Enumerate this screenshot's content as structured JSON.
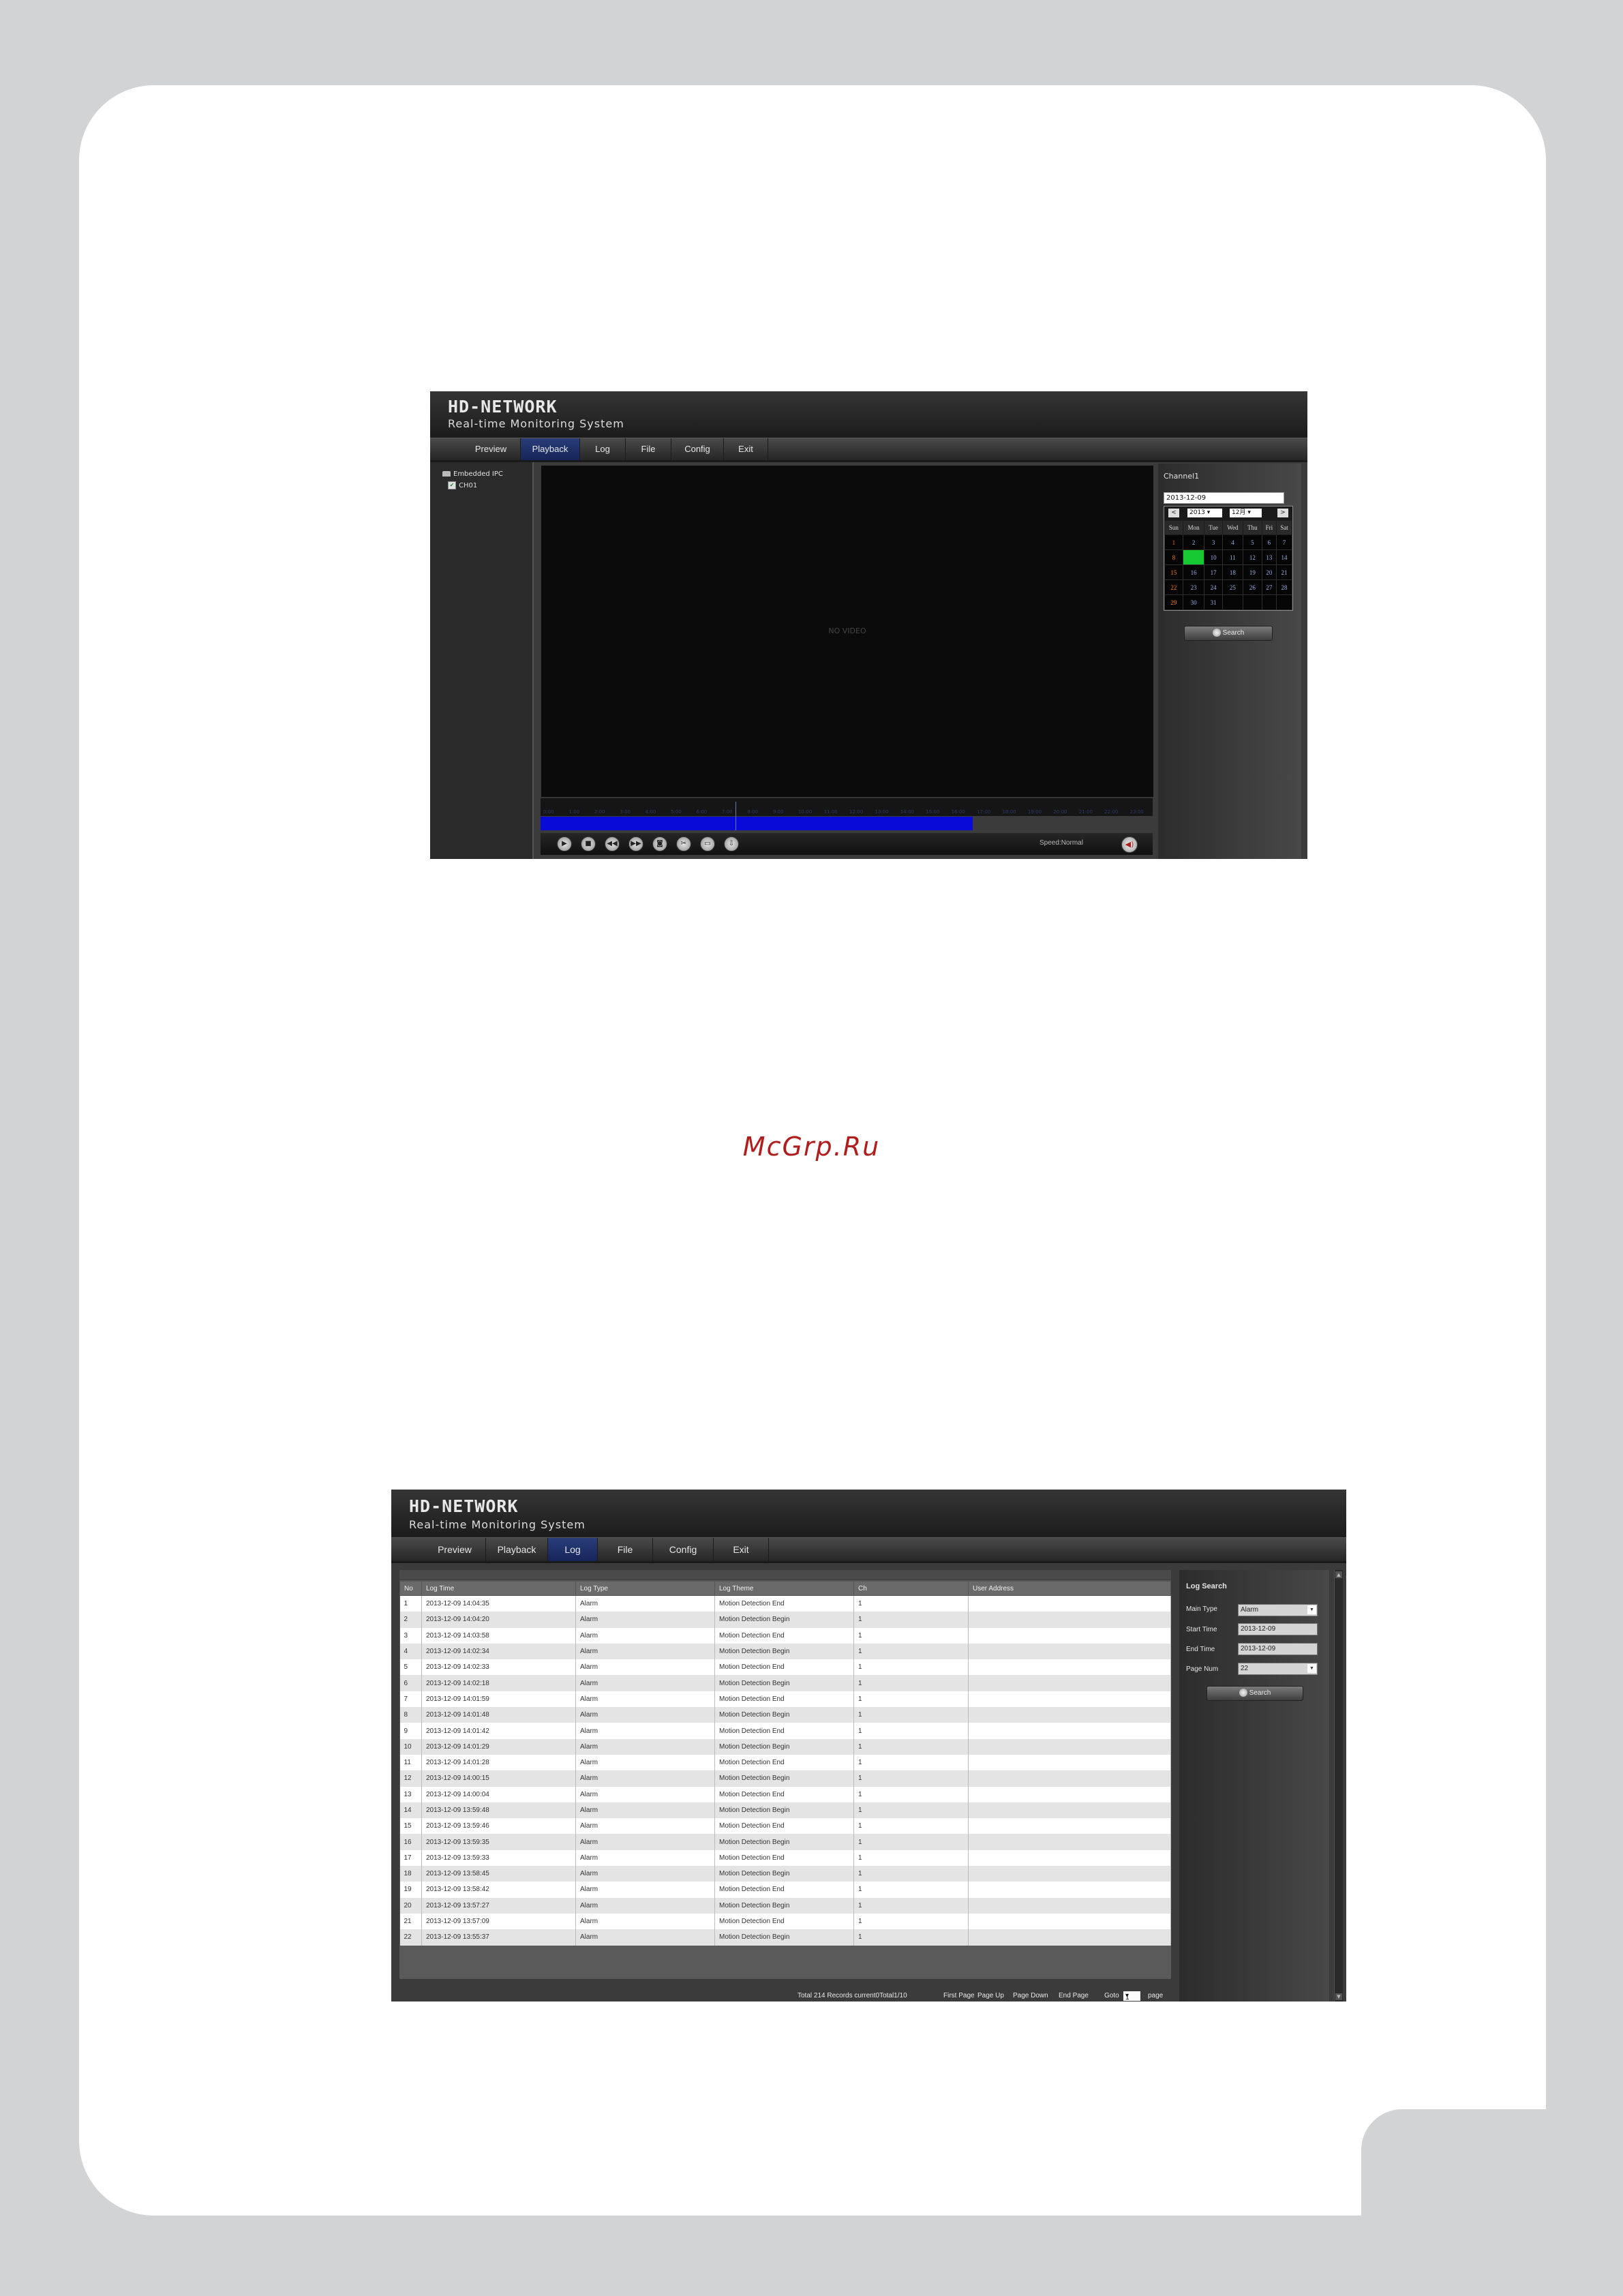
{
  "watermark": "McGrp.Ru",
  "playback": {
    "app": {
      "logo": "HD-NETWORK",
      "subtitle": "Real-time Monitoring System"
    },
    "tabs": [
      {
        "label": "Preview"
      },
      {
        "label": "Playback"
      },
      {
        "label": "Log"
      },
      {
        "label": "File"
      },
      {
        "label": "Config"
      },
      {
        "label": "Exit"
      }
    ],
    "active_tab": "Playback",
    "tree": {
      "root": "Embedded IPC",
      "channel": "CH01"
    },
    "video": {
      "status": "NO VIDEO"
    },
    "timeline_ticks": [
      "0:00",
      "1:00",
      "2:00",
      "3:00",
      "4:00",
      "5:00",
      "6:00",
      "7:00",
      "8:00",
      "9:00",
      "10:00",
      "11:00",
      "12:00",
      "13:00",
      "14:00",
      "15:00",
      "16:00",
      "17:00",
      "18:00",
      "19:00",
      "20:00",
      "21:00",
      "22:00",
      "23:00"
    ],
    "recording_fraction": 0.706,
    "controls": {
      "speed_label": "Speed",
      "speed_value": "Normal",
      "icons": [
        "play-icon",
        "stop-icon",
        "rewind-icon",
        "fast-forward-icon",
        "snapshot-icon",
        "clip-icon",
        "frame-icon",
        "download-icon"
      ]
    },
    "calendar": {
      "channel_label": "Channel1",
      "date": "2013-12-09",
      "year": "2013",
      "month": "12",
      "prev": "<",
      "next": ">",
      "weekdays": [
        "Sun",
        "Mon",
        "Tue",
        "Wed",
        "Thu",
        "Fri",
        "Sat"
      ],
      "weeks": [
        [
          "1",
          "2",
          "3",
          "4",
          "5",
          "6",
          "7"
        ],
        [
          "8",
          "9",
          "10",
          "11",
          "12",
          "13",
          "14"
        ],
        [
          "15",
          "16",
          "17",
          "18",
          "19",
          "20",
          "21"
        ],
        [
          "22",
          "23",
          "24",
          "25",
          "26",
          "27",
          "28"
        ],
        [
          "29",
          "30",
          "31",
          "",
          "",
          "",
          ""
        ]
      ],
      "selected_day": "9",
      "search_label": "Search"
    }
  },
  "log": {
    "app": {
      "logo": "HD-NETWORK",
      "subtitle": "Real-time Monitoring System"
    },
    "tabs": [
      {
        "label": "Preview"
      },
      {
        "label": "Playback"
      },
      {
        "label": "Log"
      },
      {
        "label": "File"
      },
      {
        "label": "Config"
      },
      {
        "label": "Exit"
      }
    ],
    "active_tab": "Log",
    "columns": [
      "No",
      "Log Time",
      "Log Type",
      "Log Theme",
      "Ch",
      "User Address"
    ],
    "rows": [
      [
        "1",
        "2013-12-09 14:04:35",
        "Alarm",
        "Motion Detection End",
        "1",
        ""
      ],
      [
        "2",
        "2013-12-09 14:04:20",
        "Alarm",
        "Motion Detection Begin",
        "1",
        ""
      ],
      [
        "3",
        "2013-12-09 14:03:58",
        "Alarm",
        "Motion Detection End",
        "1",
        ""
      ],
      [
        "4",
        "2013-12-09 14:02:34",
        "Alarm",
        "Motion Detection Begin",
        "1",
        ""
      ],
      [
        "5",
        "2013-12-09 14:02:33",
        "Alarm",
        "Motion Detection End",
        "1",
        ""
      ],
      [
        "6",
        "2013-12-09 14:02:18",
        "Alarm",
        "Motion Detection Begin",
        "1",
        ""
      ],
      [
        "7",
        "2013-12-09 14:01:59",
        "Alarm",
        "Motion Detection End",
        "1",
        ""
      ],
      [
        "8",
        "2013-12-09 14:01:48",
        "Alarm",
        "Motion Detection Begin",
        "1",
        ""
      ],
      [
        "9",
        "2013-12-09 14:01:42",
        "Alarm",
        "Motion Detection End",
        "1",
        ""
      ],
      [
        "10",
        "2013-12-09 14:01:29",
        "Alarm",
        "Motion Detection Begin",
        "1",
        ""
      ],
      [
        "11",
        "2013-12-09 14:01:28",
        "Alarm",
        "Motion Detection End",
        "1",
        ""
      ],
      [
        "12",
        "2013-12-09 14:00:15",
        "Alarm",
        "Motion Detection Begin",
        "1",
        ""
      ],
      [
        "13",
        "2013-12-09 14:00:04",
        "Alarm",
        "Motion Detection End",
        "1",
        ""
      ],
      [
        "14",
        "2013-12-09 13:59:48",
        "Alarm",
        "Motion Detection Begin",
        "1",
        ""
      ],
      [
        "15",
        "2013-12-09 13:59:46",
        "Alarm",
        "Motion Detection End",
        "1",
        ""
      ],
      [
        "16",
        "2013-12-09 13:59:35",
        "Alarm",
        "Motion Detection Begin",
        "1",
        ""
      ],
      [
        "17",
        "2013-12-09 13:59:33",
        "Alarm",
        "Motion Detection End",
        "1",
        ""
      ],
      [
        "18",
        "2013-12-09 13:58:45",
        "Alarm",
        "Motion Detection Begin",
        "1",
        ""
      ],
      [
        "19",
        "2013-12-09 13:58:42",
        "Alarm",
        "Motion Detection End",
        "1",
        ""
      ],
      [
        "20",
        "2013-12-09 13:57:27",
        "Alarm",
        "Motion Detection Begin",
        "1",
        ""
      ],
      [
        "21",
        "2013-12-09 13:57:09",
        "Alarm",
        "Motion Detection End",
        "1",
        ""
      ],
      [
        "22",
        "2013-12-09 13:55:37",
        "Alarm",
        "Motion Detection Begin",
        "1",
        ""
      ]
    ],
    "pager": {
      "total": "Total  214 Records  current0Total1/10",
      "first": "First Page",
      "up": "Page Up",
      "down": "Page Down",
      "end": "End Page",
      "go_label": "Goto",
      "go_value": "1",
      "page_label": "page"
    },
    "search": {
      "title": "Log Search",
      "main_type_label": "Main Type",
      "main_type_value": "Alarm",
      "start_label": "Start Time",
      "start_value": "2013-12-09",
      "end_label": "End Time",
      "end_value": "2013-12-09",
      "page_num_label": "Page Num",
      "page_num_value": "22",
      "button": "Search"
    }
  }
}
